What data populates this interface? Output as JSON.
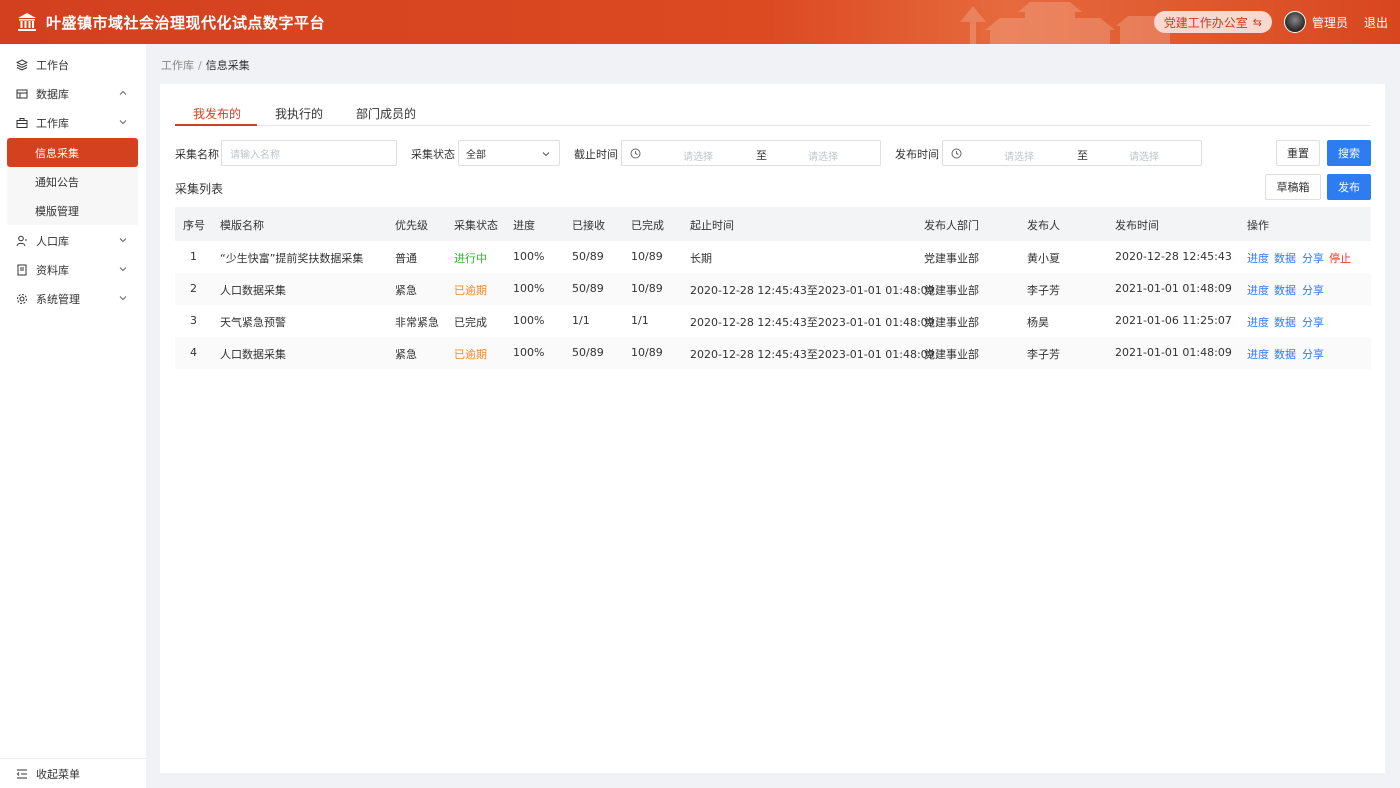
{
  "header": {
    "title": "叶盛镇市域社会治理现代化试点数字平台",
    "office_switch": "党建工作办公室",
    "admin_name": "管理员",
    "logout": "退出"
  },
  "sidebar": {
    "items": [
      {
        "label": "工作台",
        "icon": "layers-icon"
      },
      {
        "label": "数据库",
        "icon": "database-icon"
      },
      {
        "label": "工作库",
        "icon": "briefcase-icon"
      },
      {
        "label": "人口库",
        "icon": "user-icon"
      },
      {
        "label": "资料库",
        "icon": "book-icon"
      },
      {
        "label": "系统管理",
        "icon": "gear-icon"
      }
    ],
    "subitems": [
      "信息采集",
      "通知公告",
      "模版管理"
    ],
    "collapse": "收起菜单"
  },
  "breadcrumb": {
    "home": "工作库",
    "sep": "/",
    "current": "信息采集"
  },
  "tabs": [
    "我发布的",
    "我执行的",
    "部门成员的"
  ],
  "filters": {
    "name_label": "采集名称",
    "name_placeholder": "请输入名称",
    "status_label": "采集状态",
    "status_value": "全部",
    "deadline_label": "截止时间",
    "publish_label": "发布时间",
    "date_placeholder": "请选择",
    "to": "至"
  },
  "buttons": {
    "reset": "重置",
    "search": "搜索",
    "drafts": "草稿箱",
    "publish": "发布"
  },
  "list_title": "采集列表",
  "table": {
    "headers": [
      "序号",
      "模版名称",
      "优先级",
      "采集状态",
      "进度",
      "已接收",
      "已完成",
      "起止时间",
      "发布人部门",
      "发布人",
      "发布时间",
      "操作"
    ],
    "rows": [
      {
        "no": "1",
        "name": "“少生快富”提前奖扶数据采集",
        "priority": "普通",
        "status": "进行中",
        "progress": "100%",
        "received": "50/89",
        "done": "10/89",
        "period": "长期",
        "dept": "党建事业部",
        "publisher": "黄小夏",
        "time": "2020-12-28 12:45:43",
        "ops": [
          "进度",
          "数据",
          "分享",
          "停止"
        ]
      },
      {
        "no": "2",
        "name": "人口数据采集",
        "priority": "紧急",
        "status": "已逾期",
        "progress": "100%",
        "received": "50/89",
        "done": "10/89",
        "period": "2020-12-28 12:45:43至2023-01-01 01:48:09",
        "dept": "党建事业部",
        "publisher": "李子芳",
        "time": "2021-01-01 01:48:09",
        "ops": [
          "进度",
          "数据",
          "分享"
        ]
      },
      {
        "no": "3",
        "name": "天气紧急预警",
        "priority": "非常紧急",
        "status": "已完成",
        "progress": "100%",
        "received": "1/1",
        "done": "1/1",
        "period": "2020-12-28 12:45:43至2023-01-01 01:48:09",
        "dept": "党建事业部",
        "publisher": "杨昊",
        "time": "2021-01-06 11:25:07",
        "ops": [
          "进度",
          "数据",
          "分享"
        ]
      },
      {
        "no": "4",
        "name": "人口数据采集",
        "priority": "紧急",
        "status": "已逾期",
        "progress": "100%",
        "received": "50/89",
        "done": "10/89",
        "period": "2020-12-28 12:45:43至2023-01-01 01:48:09",
        "dept": "党建事业部",
        "publisher": "李子芳",
        "time": "2021-01-01 01:48:09",
        "ops": [
          "进度",
          "数据",
          "分享"
        ]
      }
    ]
  },
  "colors": {
    "brand": "#d4411f",
    "primary": "#2d7cf1",
    "in_progress": "#2cb52c",
    "overdue": "#f58a20",
    "stop": "#e23c24"
  }
}
